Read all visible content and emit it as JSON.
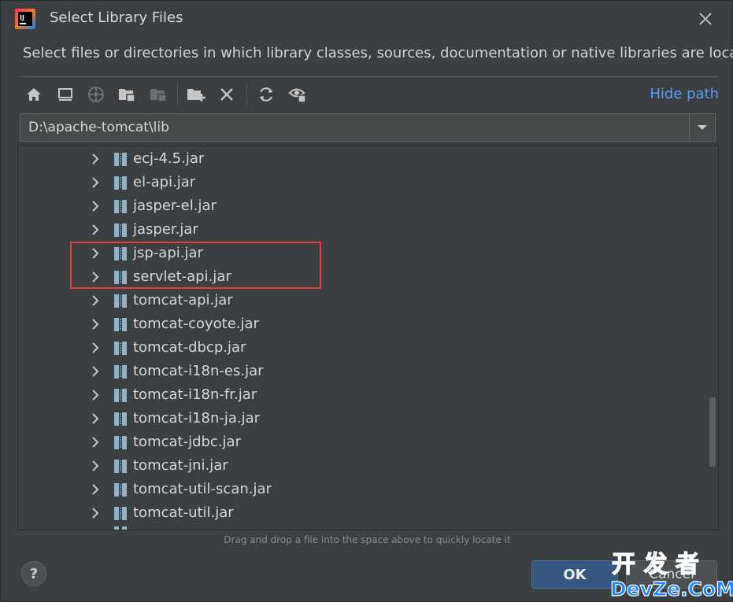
{
  "window": {
    "title": "Select Library Files",
    "description": "Select files or directories in which library classes, sources, documentation or native libraries are located"
  },
  "toolbar": {
    "icons": [
      "home-icon",
      "desktop-icon",
      "project-icon",
      "module-icon",
      "module-disabled-icon",
      "new-folder-icon",
      "delete-icon",
      "refresh-icon",
      "show-hidden-icon"
    ],
    "hide_path_label": "Hide path"
  },
  "path": {
    "value": "D:\\apache-tomcat\\lib"
  },
  "tree": {
    "items": [
      {
        "name": "ecj-4.5.jar"
      },
      {
        "name": "el-api.jar"
      },
      {
        "name": "jasper-el.jar"
      },
      {
        "name": "jasper.jar"
      },
      {
        "name": "jsp-api.jar"
      },
      {
        "name": "servlet-api.jar"
      },
      {
        "name": "tomcat-api.jar"
      },
      {
        "name": "tomcat-coyote.jar"
      },
      {
        "name": "tomcat-dbcp.jar"
      },
      {
        "name": "tomcat-i18n-es.jar"
      },
      {
        "name": "tomcat-i18n-fr.jar"
      },
      {
        "name": "tomcat-i18n-ja.jar"
      },
      {
        "name": "tomcat-jdbc.jar"
      },
      {
        "name": "tomcat-jni.jar"
      },
      {
        "name": "tomcat-util-scan.jar"
      },
      {
        "name": "tomcat-util.jar"
      }
    ]
  },
  "footer": {
    "drop_hint": "Drag and drop a file into the space above to quickly locate it",
    "help_label": "?",
    "ok_label": "OK",
    "cancel_label": "Cancel"
  },
  "watermark": {
    "line1": "开 发 者",
    "line2": "DevZe.CoM"
  },
  "colors": {
    "background": "#3c3f41",
    "accent_link": "#589df6",
    "ok_button": "#365880",
    "highlight_box": "#e43d3d",
    "jar_icon": "#8fb4c9"
  }
}
